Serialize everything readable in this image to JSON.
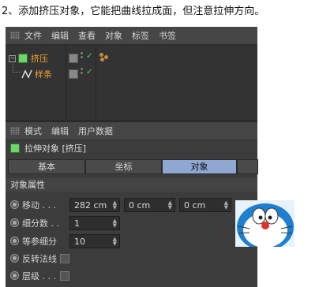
{
  "caption": "2、添加挤压对象，它能把曲线拉成面，但注意拉伸方向。",
  "object_manager": {
    "menu": [
      "文件",
      "编辑",
      "查看",
      "对象",
      "标签",
      "书签"
    ],
    "objects": [
      {
        "label": "挤压",
        "icon": "cube-icon"
      },
      {
        "label": "样条",
        "icon": "spline-icon"
      }
    ]
  },
  "attribute_manager": {
    "menu": [
      "模式",
      "编辑",
      "用户数据"
    ],
    "title": "拉伸对象 [挤压]",
    "tabs": [
      "基本",
      "坐标",
      "对象"
    ],
    "active_tab": "对象",
    "section": "对象属性",
    "properties": [
      {
        "label": "移动 . . .",
        "values": [
          "282 cm",
          "0 cm",
          "0 cm"
        ]
      },
      {
        "label": "细分数 . .",
        "values": [
          "1"
        ]
      },
      {
        "label": "等参细分",
        "values": [
          "10"
        ]
      },
      {
        "label": "反转法线",
        "checkbox": false
      },
      {
        "label": "层级 . . .",
        "checkbox": false
      }
    ]
  },
  "colors": {
    "panel_bg": "#3c3c3c",
    "active_tab": "#8fa8d2",
    "object_label": "#f0a030"
  }
}
